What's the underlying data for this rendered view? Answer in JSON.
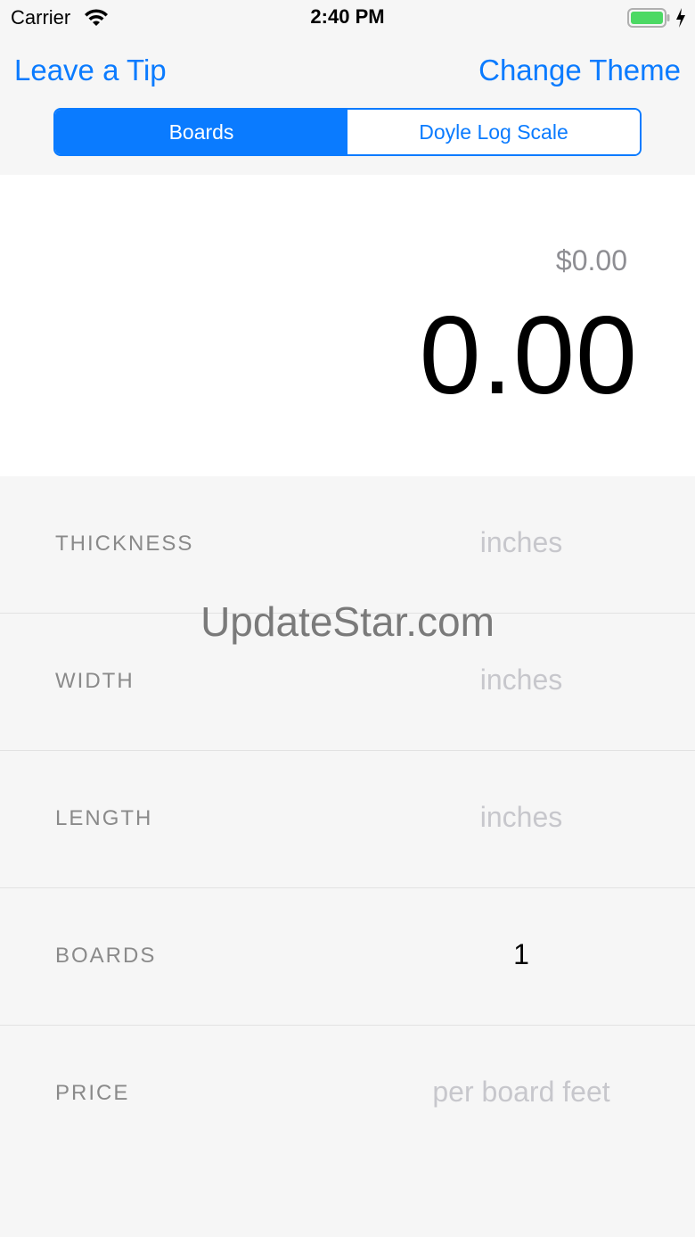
{
  "status_bar": {
    "carrier": "Carrier",
    "time": "2:40 PM",
    "wifi_icon": "wifi-icon",
    "battery_icon": "battery-charging-icon",
    "battery_color": "#4cd964"
  },
  "nav": {
    "left_label": "Leave a Tip",
    "right_label": "Change Theme",
    "accent_color": "#0a7bff"
  },
  "segmented": {
    "options": [
      "Boards",
      "Doyle Log Scale"
    ],
    "selected": "Boards"
  },
  "result": {
    "price": "$0.00",
    "board_feet": "0.00"
  },
  "fields": [
    {
      "label": "THICKNESS",
      "placeholder": "inches",
      "value": ""
    },
    {
      "label": "WIDTH",
      "placeholder": "inches",
      "value": ""
    },
    {
      "label": "LENGTH",
      "placeholder": "inches",
      "value": ""
    },
    {
      "label": "BOARDS",
      "placeholder": "",
      "value": "1"
    },
    {
      "label": "PRICE",
      "placeholder": "per board feet",
      "value": ""
    }
  ],
  "watermark": "UpdateStar.com"
}
